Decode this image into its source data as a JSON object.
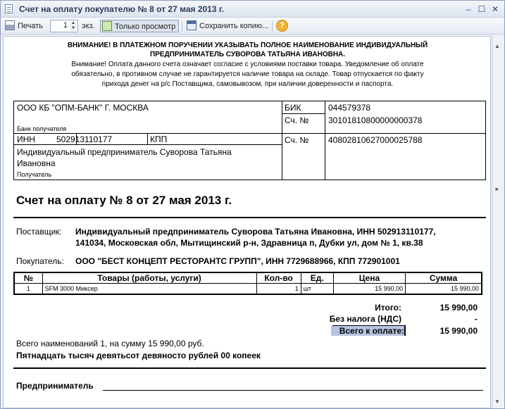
{
  "window": {
    "title": "Счет на оплату покупателю № 8 от 27 мая 2013 г."
  },
  "toolbar": {
    "print_label": "Печать",
    "copies_value": "1",
    "copies_unit": "экз.",
    "preview_label": "Только просмотр",
    "save_label": "Сохранить копию...",
    "help_symbol": "?"
  },
  "notice": {
    "warning_line1": "ВНИМАНИЕ! В ПЛАТЕЖНОМ ПОРУЧЕНИИ УКАЗЫВАТЬ ПОЛНОЕ НАИМЕНОВАНИЕ ИНДИВИДУАЛЬНЫЙ",
    "warning_line2": "ПРЕДПРИНИМАТЕЛЬ СУВОРОВА ТАТЬЯНА ИВАНОВНА.",
    "text_line1": "Внимание! Оплата данного счета означает согласие с условиями поставки товара. Уведомление об оплате",
    "text_line2": "обязательно, в противном случае не гарантируется наличие товара на складе. Товар отпускается по факту",
    "text_line3": "прихода денег на р/с Поставщика, самовывозом, при наличии доверенности и паспорта."
  },
  "bank": {
    "bank_name": "ООО КБ \"ОПМ-БАНК\" Г. МОСКВА",
    "bank_label": "Банк получателя",
    "bik_label": "БИК",
    "bik_value": "044579378",
    "corr_label": "Сч. №",
    "corr_value": "30101810800000000378",
    "inn_label": "ИНН",
    "inn_value": "502913110177",
    "kpp_label": "КПП",
    "recipient_name_line1": "Индивидуальный предприниматель Суворова Татьяна",
    "recipient_name_line2": "Ивановна",
    "recipient_label": "Получатель",
    "acc_label": "Сч. №",
    "acc_value": "40802810627000025788"
  },
  "invoice": {
    "title": "Счет на оплату № 8 от 27 мая 2013 г.",
    "supplier_label": "Поставщик:",
    "supplier_line1": "Индивидуальный предприниматель Суворова Татьяна Ивановна, ИНН 502913110177,",
    "supplier_line2": "141034, Московская обл, Мытищинский р-н, Здравница п, Дубки ул, дом № 1, кв.38",
    "buyer_label": "Покупатель:",
    "buyer_value": "ООО \"БЕСТ КОНЦЕПТ РЕСТОРАНТС ГРУПП\", ИНН 7729688966, КПП 772901001"
  },
  "table": {
    "headers": [
      "№",
      "Товары (работы, услуги)",
      "Кол-во",
      "Ед.",
      "Цена",
      "Сумма"
    ],
    "rows": [
      [
        "1",
        "SFM 3000 Миксер",
        "1",
        "шт",
        "15 990,00",
        "15 990,00"
      ]
    ]
  },
  "totals": {
    "total_label": "Итого:",
    "total_value": "15 990,00",
    "vat_label": "Без налога (НДС)",
    "vat_value": "-",
    "due_label": "Всего к оплате:",
    "due_value": "15 990,00"
  },
  "summary": {
    "count_line": "Всего наименований 1, на сумму 15 990,00 руб.",
    "words_line": "Пятнадцать тысяч девятьсот девяносто рублей 00 копеек",
    "signer_label": "Предприниматель"
  }
}
